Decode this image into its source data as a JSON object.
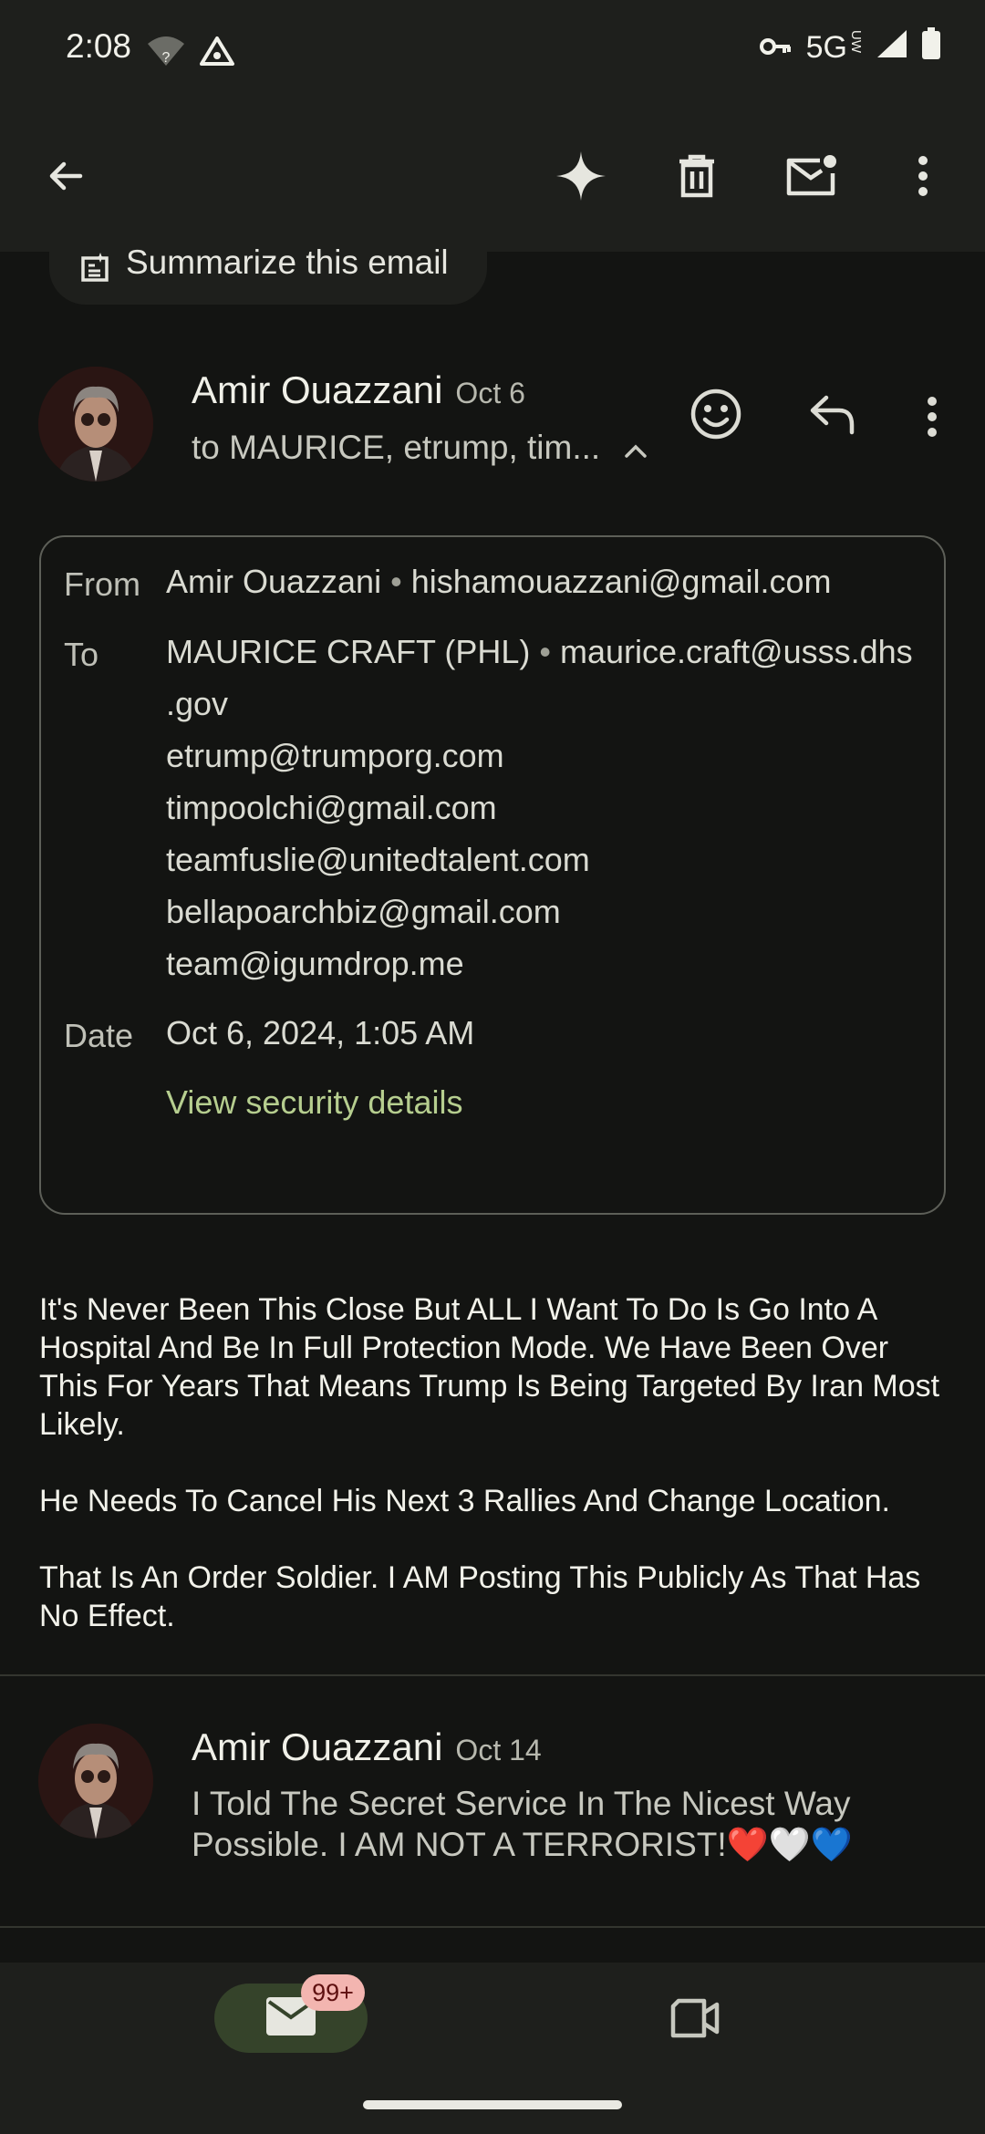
{
  "status_bar": {
    "time": "2:08",
    "network": "5G",
    "network_sub": "UW"
  },
  "app_bar": {
    "back_icon": "arrow-back-icon",
    "gemini_icon": "sparkle-icon",
    "delete_icon": "trash-icon",
    "mark_unread_icon": "mail-unread-icon",
    "more_icon": "more-vert-icon"
  },
  "summarize_chip": {
    "label": "Summarize this email"
  },
  "message1": {
    "sender": "Amir Ouazzani",
    "date": "Oct 6",
    "to_summary": "to MAURICE, etrump, tim...",
    "details": {
      "from_label": "From",
      "from_name": "Amir Ouazzani",
      "from_email": "hishamouazzani@gmail.com",
      "to_label": "To",
      "to_first_name": "MAURICE CRAFT (PHL)",
      "to_first_email_line1": "maurice.craft@usss.dhs",
      "to_first_email_line2": ".gov",
      "to_others": [
        "etrump@trumporg.com",
        "timpoolchi@gmail.com",
        "teamfuslie@unitedtalent.com",
        "bellapoarchbiz@gmail.com",
        "team@igumdrop.me"
      ],
      "date_label": "Date",
      "date_value": "Oct 6, 2024, 1:05 AM",
      "security_link": "View security details"
    },
    "body": [
      "It's Never Been This Close But ALL I Want To Do Is Go Into A Hospital And Be In Full Protection Mode. We Have Been Over This For Years That Means Trump Is Being Targeted By Iran Most Likely.",
      "He Needs To Cancel His Next 3 Rallies And Change Location.",
      "That Is An Order Soldier. I AM Posting This Publicly As That Has No Effect."
    ]
  },
  "message2": {
    "sender": "Amir Ouazzani",
    "date": "Oct 14",
    "snippet": "I Told The Secret Service In The Nicest Way Possible. I AM NOT A TERRORIST!❤️🤍💙"
  },
  "bottom_nav": {
    "mail_badge": "99+",
    "mail_icon": "mail-icon",
    "meet_icon": "video-camera-icon"
  }
}
